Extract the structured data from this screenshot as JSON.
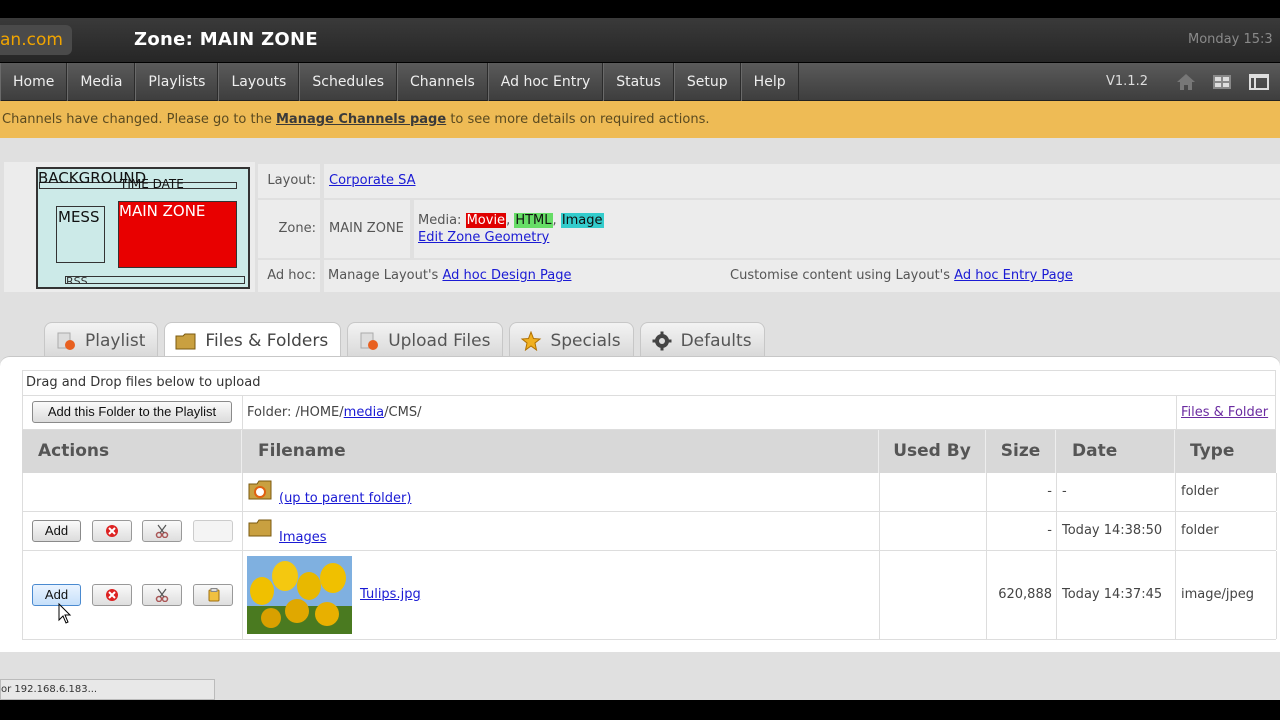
{
  "header": {
    "brand": "an.com",
    "zone_title": "Zone: MAIN ZONE",
    "datetime": "Monday 15:3"
  },
  "nav": {
    "items": [
      "Home",
      "Media",
      "Playlists",
      "Layouts",
      "Schedules",
      "Channels",
      "Ad hoc Entry",
      "Status",
      "Setup",
      "Help"
    ],
    "version": "V1.1.2",
    "icons": [
      "home-icon",
      "dashboard-icon",
      "window-icon"
    ]
  },
  "notice": {
    "before": "Channels have changed. Please go to the ",
    "link": "Manage Channels page",
    "after": " to see more details on required actions."
  },
  "preview": {
    "background": "BACKGROUND",
    "time_date": "TIME DATE",
    "mess": "MESS",
    "main_zone": "MAIN ZONE",
    "rss": "RSS"
  },
  "info": {
    "layout_label": "Layout:",
    "layout_value": "Corporate SA",
    "zone_label": "Zone:",
    "zone_value": "MAIN ZONE",
    "media_label": "Media:",
    "media_movie": "Movie",
    "media_html": "HTML",
    "media_image": "Image",
    "sep": ",",
    "edit_geometry": "Edit Zone Geometry",
    "adhoc_label": "Ad hoc:",
    "adhoc_left_text": "Manage Layout's ",
    "adhoc_left_link": "Ad hoc Design Page",
    "adhoc_right_text": "Customise content using Layout's ",
    "adhoc_right_link": "Ad hoc Entry Page"
  },
  "tabs": [
    {
      "label": "Playlist",
      "icon": "playlist-icon"
    },
    {
      "label": "Files & Folders",
      "icon": "folder-icon"
    },
    {
      "label": "Upload Files",
      "icon": "upload-icon"
    },
    {
      "label": "Specials",
      "icon": "star-icon"
    },
    {
      "label": "Defaults",
      "icon": "gear-icon"
    }
  ],
  "files": {
    "dropzone": "Drag and Drop files below to upload",
    "add_folder_button": "Add this Folder to the Playlist",
    "folder_prefix": "Folder: /HOME/",
    "folder_media": "media",
    "folder_suffix": "/CMS/",
    "files_folder_link": "Files & Folder",
    "columns": [
      "Actions",
      "Filename",
      "Used By",
      "Size",
      "Date",
      "Type"
    ],
    "rows": [
      {
        "name": "(up to parent folder)",
        "used_by": "",
        "size": "-",
        "date": "-",
        "type": "folder"
      },
      {
        "name": "Images",
        "used_by": "",
        "size": "-",
        "date": "Today 14:38:50",
        "type": "folder",
        "add": "Add"
      },
      {
        "name": "Tulips.jpg",
        "used_by": "",
        "size": "620,888",
        "date": "Today 14:37:45",
        "type": "image/jpeg",
        "add": "Add"
      }
    ]
  },
  "statusbar": "or 192.168.6.183...",
  "colors": {
    "movie": "#e00000",
    "html": "#66dd66",
    "image": "#33cccc",
    "accent": "#f0a400"
  }
}
